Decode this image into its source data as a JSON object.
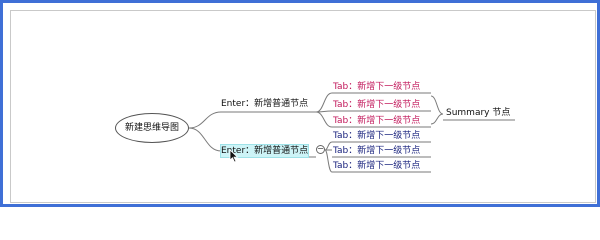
{
  "mindmap": {
    "root": {
      "label": "新建思维导图"
    },
    "branches": [
      {
        "label": "Enter：新增普通节点",
        "children": [
          {
            "label": "Tab：新增下一级节点"
          },
          {
            "label": "Tab：新增下一级节点"
          },
          {
            "label": "Tab：新增下一级节点"
          }
        ],
        "summary": {
          "label": "Summary 节点"
        }
      },
      {
        "label": "Enter：新增普通节点",
        "children": [
          {
            "label": "Tab：新增下一级节点"
          },
          {
            "label": "Tab：新增下一级节点"
          },
          {
            "label": "Tab：新增下一级节点"
          }
        ],
        "collapse_symbol": "−"
      }
    ]
  },
  "colors": {
    "frame_border": "#3f6fd6",
    "subnode_pink": "#c2185b",
    "subnode_navy": "#1a237e",
    "selected_fill": "#cdf4f7"
  },
  "icons": {
    "collapse": "collapse-toggle-icon",
    "cursor": "mouse-pointer-icon"
  }
}
